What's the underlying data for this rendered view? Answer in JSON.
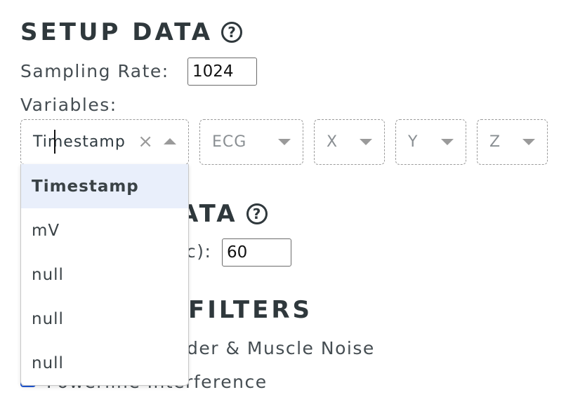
{
  "setup": {
    "title": "SETUP DATA",
    "help_glyph": "?",
    "sampling_rate_label": "Sampling Rate:",
    "sampling_rate_value": "1024",
    "variables_label": "Variables:",
    "selects": [
      {
        "value": "Timestamp",
        "open": true
      },
      {
        "value": "ECG"
      },
      {
        "value": "X"
      },
      {
        "value": "Y"
      },
      {
        "value": "Z"
      }
    ],
    "clear_glyph": "×"
  },
  "dropdown": {
    "options": [
      "Timestamp",
      "mV",
      "null",
      "null",
      "null"
    ],
    "active_index": 0
  },
  "section2": {
    "title_visible": "ATA",
    "help_glyph": "?",
    "label_visible": "c):",
    "value": "60"
  },
  "section3": {
    "title_visible": "FILTERS",
    "filter1_visible": "der & Muscle Noise",
    "filter2_visible": "Powerline Interference"
  },
  "colors": {
    "heading": "#2f383c",
    "checkbox_accent": "#1f57d6",
    "active_option_bg": "#e9effb"
  }
}
